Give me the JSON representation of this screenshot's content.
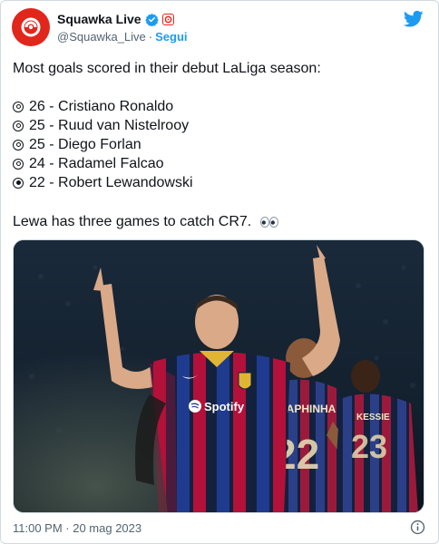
{
  "tweet": {
    "display_name": "Squawka Live",
    "handle": "@Squawka_Live",
    "separator": "·",
    "follow_label": "Segui",
    "intro": "Most goals scored in their debut LaLiga season:",
    "list": [
      {
        "text": "26 - Cristiano Ronaldo",
        "filled": false
      },
      {
        "text": "25 - Ruud van Nistelrooy",
        "filled": false
      },
      {
        "text": "25 - Diego Forlan",
        "filled": false
      },
      {
        "text": "24 - Radamel Falcao",
        "filled": false
      },
      {
        "text": "22 - Robert Lewandowski",
        "filled": true
      }
    ],
    "outro": "Lewa has three games to catch CR7.",
    "timestamp": "11:00 PM · 20 mag 2023"
  },
  "media": {
    "sponsor": "Spotify",
    "back_name": "RAPHINHA",
    "back_number": "22",
    "back_name_2": "KESSIE",
    "back_number_2": "23"
  },
  "colors": {
    "brand_red": "#e1261c",
    "twitter_blue": "#1d9bf0",
    "verified_blue": "#1d9bf0",
    "text": "#0f1419",
    "muted": "#536471",
    "barca_blue": "#1f3b8f",
    "barca_red": "#b3113a",
    "barca_navy": "#14213d"
  },
  "icons": {
    "avatar": "squawka-logo",
    "verified": "verified-badge-icon",
    "brand": "brand-badge-icon",
    "logo": "twitter-bird-icon",
    "info": "info-icon",
    "bullet": "radio-bullet-icon",
    "eyes": "eyes-emoji-icon"
  }
}
